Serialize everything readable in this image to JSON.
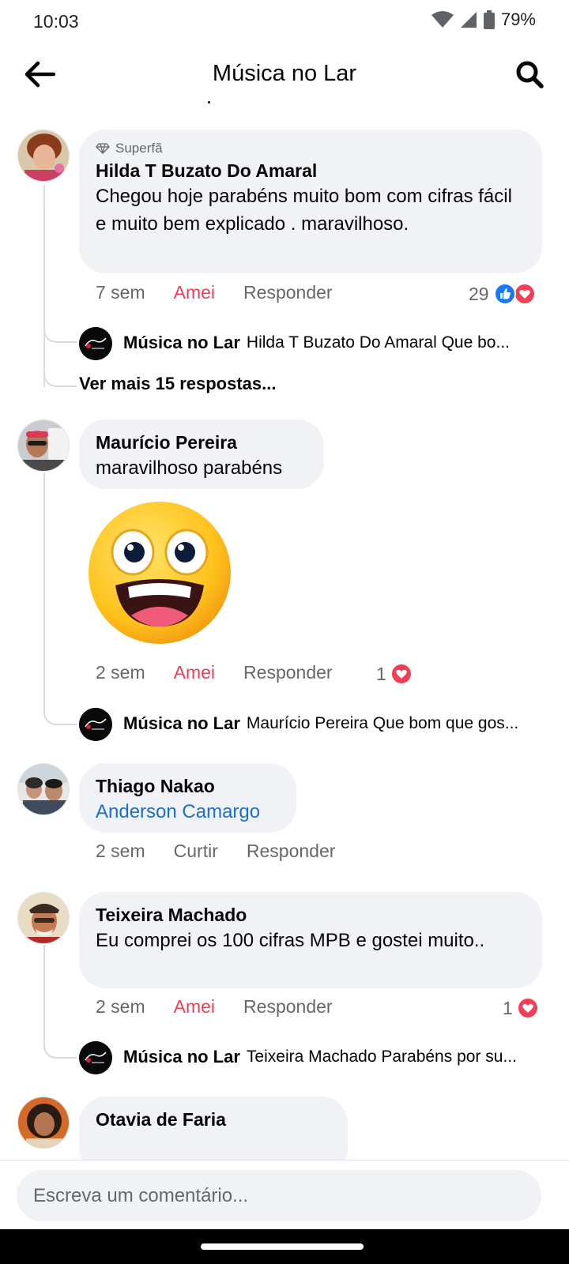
{
  "status": {
    "time": "10:03",
    "battery": "79%"
  },
  "header": {
    "title": "Música no Lar",
    "back_icon": "arrow-left-icon",
    "search_icon": "search-icon"
  },
  "comments": [
    {
      "badge": "Superfã",
      "author": "Hilda T Buzato Do Amaral",
      "text": "Chegou hoje parabéns muito bom com cifras fácil e muito bem explicado . maravilhoso.",
      "time": "7 sem",
      "reaction_action": "Amei",
      "reply_action": "Responder",
      "reaction_count": "29",
      "reply": {
        "author": "Música no Lar",
        "text": "Hilda T Buzato Do Amaral Que bo..."
      },
      "more_replies": "Ver mais 15 respostas..."
    },
    {
      "author": "Maurício Pereira",
      "text": "maravilhoso parabéns",
      "time": "2 sem",
      "reaction_action": "Amei",
      "reply_action": "Responder",
      "reaction_count": "1",
      "reply": {
        "author": "Música no Lar",
        "text": "Maurício Pereira Que bom que gos..."
      }
    },
    {
      "author": "Thiago Nakao",
      "text": "Anderson Camargo",
      "time": "2 sem",
      "reaction_action": "Curtir",
      "reply_action": "Responder"
    },
    {
      "author": "Teixeira Machado",
      "text": "Eu comprei os 100 cifras MPB e gostei muito..",
      "time": "2 sem",
      "reaction_action": "Amei",
      "reply_action": "Responder",
      "reaction_count": "1",
      "reply": {
        "author": "Música no Lar",
        "text": "Teixeira Machado Parabéns por su..."
      }
    },
    {
      "author": "Otavia de Faria"
    }
  ],
  "composer": {
    "placeholder": "Escreva um comentário..."
  },
  "colors": {
    "love": "#e4415a",
    "like": "#1877f2",
    "mention": "#1b6fc6",
    "bubble": "#f0f2f5"
  }
}
